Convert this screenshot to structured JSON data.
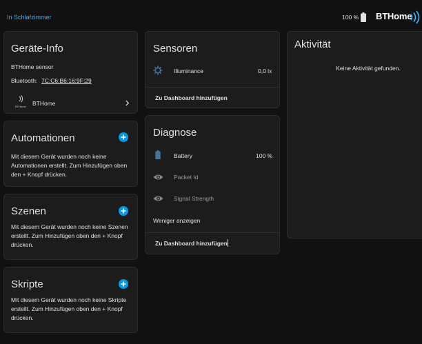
{
  "header": {
    "breadcrumb": "In Schlafzimmer",
    "battery_percent": "100 %",
    "brand": "BTHome"
  },
  "device_info": {
    "title": "Geräte-Info",
    "model": "BTHome sensor",
    "bluetooth_label": "Bluetooth:",
    "bluetooth_address": "7C:C6:B6:16:9F:29",
    "integration_logo_text": "BTHome",
    "integration_name": "BTHome"
  },
  "automations": {
    "title": "Automationen",
    "text": "Mit diesem Gerät wurden noch keine Automationen erstellt. Zum Hinzufügen oben den + Knopf drücken."
  },
  "scenes": {
    "title": "Szenen",
    "text": "Mit diesem Gerät wurden noch keine Szenen erstellt. Zum Hinzufügen oben den + Knopf drücken."
  },
  "scripts": {
    "title": "Skripte",
    "text": "Mit diesem Gerät wurden noch keine Skripte erstellt. Zum Hinzufügen oben den + Knopf drücken."
  },
  "sensors": {
    "title": "Sensoren",
    "items": [
      {
        "icon": "brightness-gear-icon",
        "label": "Illuminance",
        "value": "0,0 lx"
      }
    ],
    "add_dashboard": "Zu Dashboard hinzufügen"
  },
  "diagnostics": {
    "title": "Diagnose",
    "items": [
      {
        "icon": "battery-icon",
        "label": "Battery",
        "value": "100 %"
      },
      {
        "icon": "eye-icon",
        "label": "Packet Id",
        "value": ""
      },
      {
        "icon": "eye-icon",
        "label": "Signal Strength",
        "value": ""
      }
    ],
    "show_less": "Weniger anzeigen",
    "add_dashboard": "Zu Dashboard hinzufügen"
  },
  "activity": {
    "title": "Aktivität",
    "empty": "Keine Aktivität gefunden."
  },
  "colors": {
    "background": "#111111",
    "card": "#1c1c1c",
    "accent": "#41a9f0",
    "plus_button": "#039be5",
    "battery_icon": "#44739e"
  }
}
